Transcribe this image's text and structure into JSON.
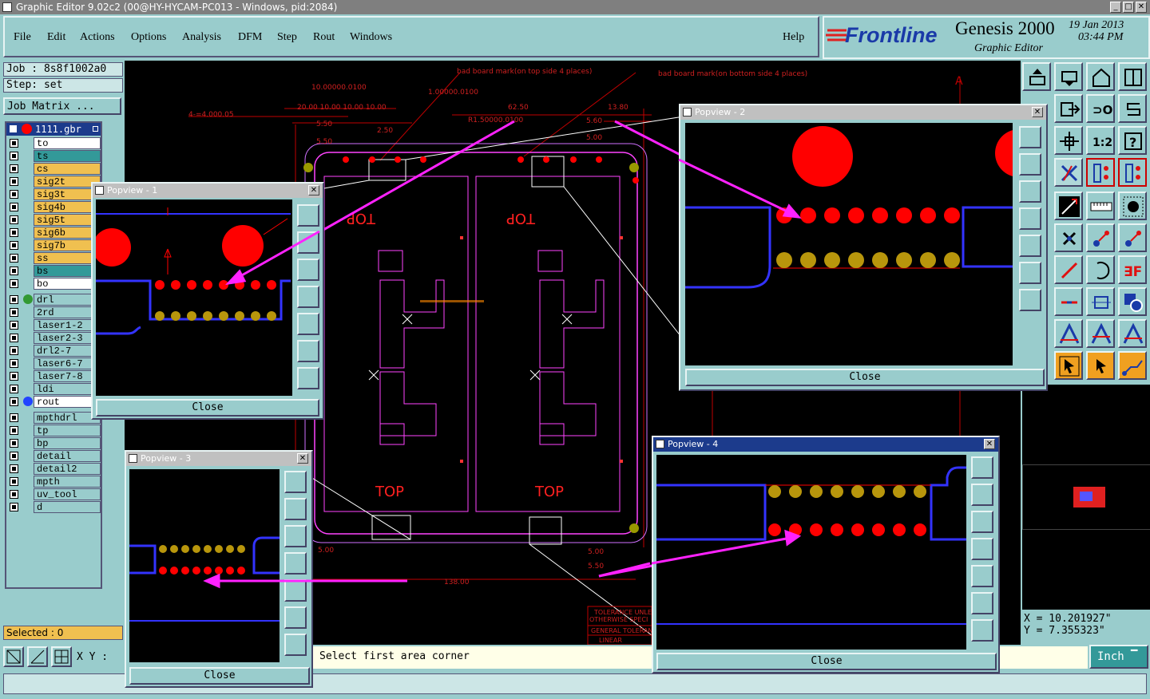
{
  "window": {
    "title": "Graphic Editor 9.02c2 (00@HY-HYCAM-PC013 - Windows, pid:2084)",
    "min": "_",
    "max": "□",
    "close": "✕"
  },
  "menu": {
    "file": "File",
    "edit": "Edit",
    "actions": "Actions",
    "options": "Options",
    "analysis": "Analysis",
    "dfm": "DFM",
    "step": "Step",
    "rout": "Rout",
    "windows": "Windows",
    "help": "Help"
  },
  "brand": {
    "logo": "Frontline",
    "product": "Genesis 2000",
    "subtitle": "Graphic Editor",
    "date": "19 Jan 2013",
    "time": "03:44 PM"
  },
  "job": {
    "job": "Job : 8s8f1002a0",
    "step": "Step: set",
    "matrix_button": "Job Matrix ..."
  },
  "layers": {
    "header": "1111.gbr",
    "group1": [
      "to",
      "ts",
      "cs",
      "sig2t",
      "sig3t",
      "sig4b",
      "sig5t",
      "sig6b",
      "sig7b",
      "ss",
      "bs",
      "bo"
    ],
    "group2": [
      "drl",
      "2rd",
      "laser1-2",
      "laser2-3",
      "drl2-7",
      "laser6-7",
      "laser7-8",
      "ldi",
      "rout"
    ],
    "group3": [
      "mpthdrl",
      "tp",
      "bp",
      "detail",
      "detail2",
      "mpth",
      "uv_tool",
      "d"
    ]
  },
  "colors": {
    "accent": "#99cccc",
    "copper": "#ff0000",
    "solder": "#b8960c",
    "outline": "#ff33ff",
    "board": "#3333ff"
  },
  "status": {
    "selected": "Selected : 0",
    "xy_label": "X Y :",
    "prompt": "Select first area corner",
    "units": "Inch",
    "x": "X  =  10.201927\"",
    "y": "Y  =  7.355323\""
  },
  "drawing": {
    "dims": [
      "4-=4.000.05",
      "10.00000.0100",
      "20.00 10.00 10.00 10.00",
      "5.50",
      "5.50",
      "62.50",
      "13.80",
      "5.60",
      "5.00",
      "1.00000.0100",
      "R1.50000.0100",
      "5.00",
      "138.00",
      "5.00",
      "5.50",
      "2.50"
    ],
    "notes": [
      "bad board mark(on top side 4 places)",
      "bad board mark(on bottom side 4 places)"
    ],
    "silk": [
      "TOP",
      "TOP",
      "TOP",
      "TOP"
    ],
    "title_block": [
      "TOLERANCE UNLE",
      "OTHERWISE SPECI",
      "GENERAL TOLERANCE",
      "LINEAR"
    ],
    "mark": "A"
  },
  "popups": [
    {
      "title": "Popview - 1",
      "close": "Close"
    },
    {
      "title": "Popview - 2",
      "close": "Close"
    },
    {
      "title": "Popview - 3",
      "close": "Close"
    },
    {
      "title": "Popview - 4",
      "close": "Close"
    }
  ]
}
